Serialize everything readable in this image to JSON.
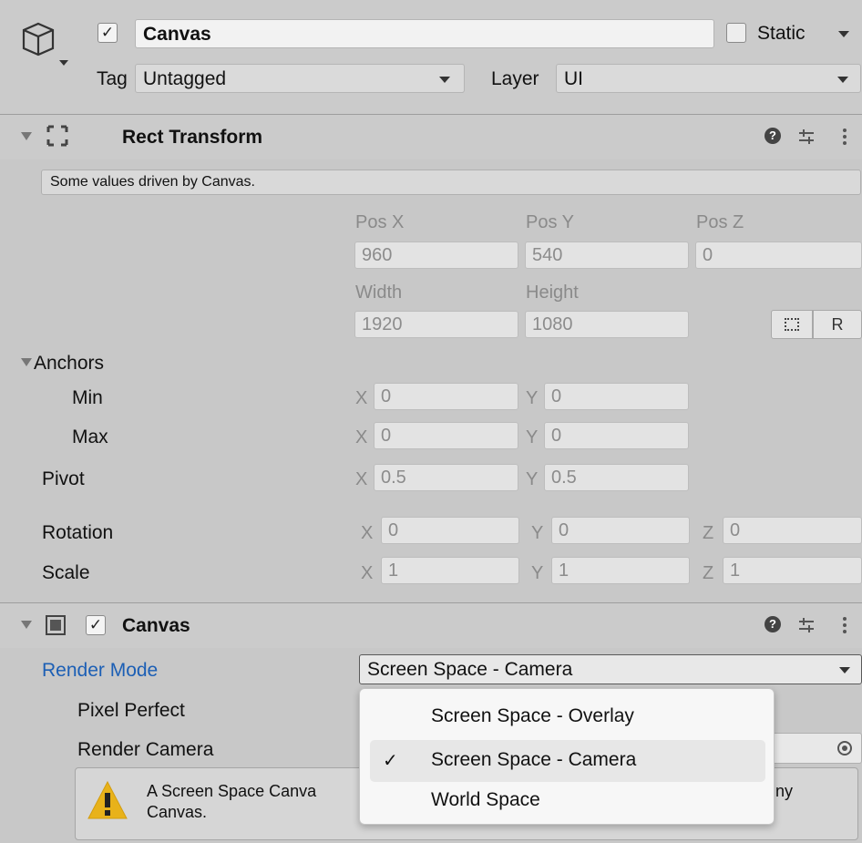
{
  "gameobject": {
    "name": "Canvas",
    "static_label": "Static",
    "tag_label": "Tag",
    "tag_value": "Untagged",
    "layer_label": "Layer",
    "layer_value": "UI"
  },
  "rect_transform": {
    "title": "Rect Transform",
    "driven_note": "Some values driven by Canvas.",
    "pos_x_label": "Pos X",
    "pos_y_label": "Pos Y",
    "pos_z_label": "Pos Z",
    "pos_x": "960",
    "pos_y": "540",
    "pos_z": "0",
    "width_label": "Width",
    "height_label": "Height",
    "width": "1920",
    "height": "1080",
    "raw_button": "R",
    "anchors_label": "Anchors",
    "min_label": "Min",
    "max_label": "Max",
    "min_x": "0",
    "min_y": "0",
    "max_x": "0",
    "max_y": "0",
    "pivot_label": "Pivot",
    "pivot_x": "0.5",
    "pivot_y": "0.5",
    "rotation_label": "Rotation",
    "rot_x": "0",
    "rot_y": "0",
    "rot_z": "0",
    "scale_label": "Scale",
    "scale_x": "1",
    "scale_y": "1",
    "scale_z": "1",
    "x": "X",
    "y": "Y",
    "z": "Z"
  },
  "canvas": {
    "title": "Canvas",
    "render_mode_label": "Render Mode",
    "render_mode_value": "Screen Space - Camera",
    "pixel_perfect_label": "Pixel Perfect",
    "render_camera_label": "Render Camera",
    "warning_line1": "A Screen Space Canva",
    "warning_line1_tail": "ny",
    "warning_line2": "Canvas."
  },
  "dropdown": {
    "options": [
      "Screen Space - Overlay",
      "Screen Space - Camera",
      "World Space"
    ],
    "selected": "Screen Space - Camera"
  },
  "colors": {
    "link_blue": "#1c5fb5",
    "warning_yellow": "#e8b21a"
  }
}
